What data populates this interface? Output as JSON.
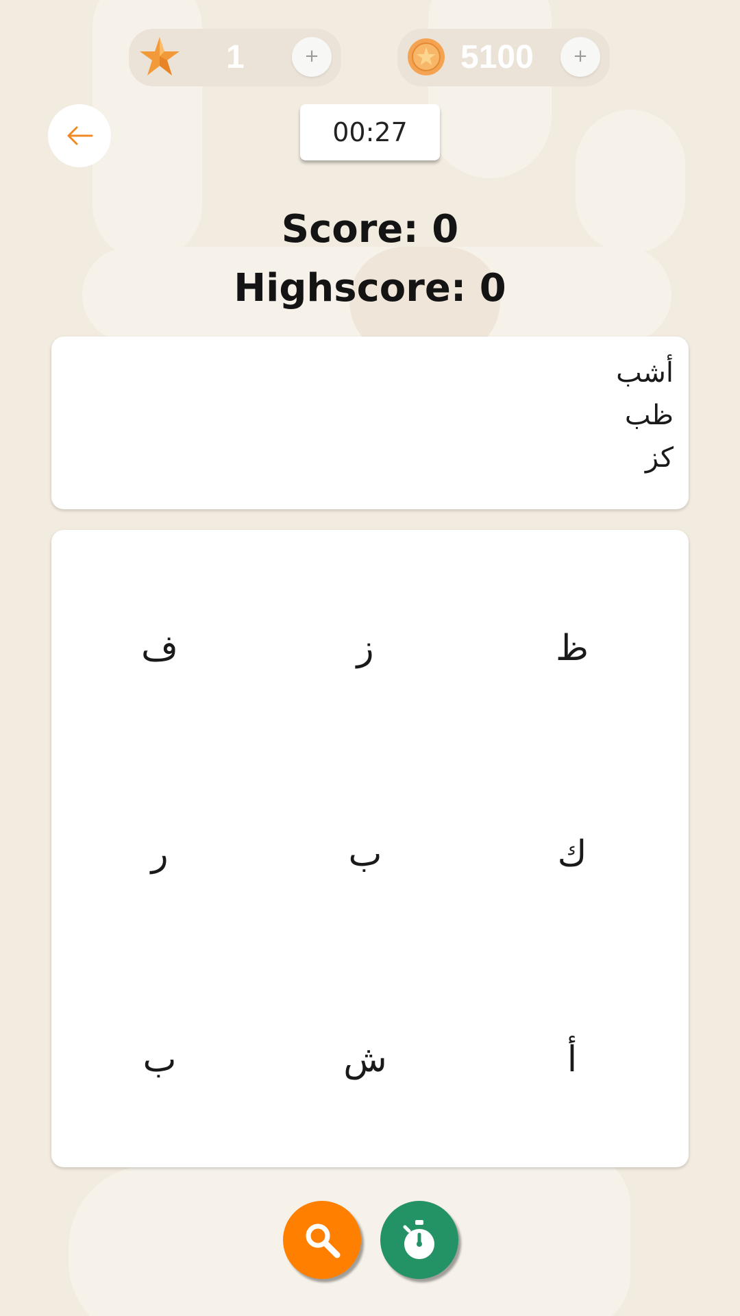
{
  "resources": {
    "stars": {
      "icon": "star-icon",
      "value": "1",
      "add_label": "+"
    },
    "coins": {
      "icon": "coin-icon",
      "value": "5100",
      "add_label": "+"
    }
  },
  "navigation": {
    "back_icon": "arrow-left-icon"
  },
  "timer": {
    "value": "00:27"
  },
  "score": {
    "label": "Score: 0",
    "highscore_label": "Highscore: 0"
  },
  "target_words": [
    "أشب",
    "ظب",
    "كز"
  ],
  "letter_grid": [
    [
      "ظ",
      "ز",
      "ف"
    ],
    [
      "ك",
      "ب",
      "ر"
    ],
    [
      "أ",
      "ش",
      "ب"
    ]
  ],
  "actions": {
    "hint": {
      "icon": "magnifier-icon",
      "color": "#ff8000"
    },
    "freeze_time": {
      "icon": "stopwatch-icon",
      "color": "#239366"
    }
  },
  "colors": {
    "background": "#f2ebdf",
    "accent": "#f08a24"
  }
}
